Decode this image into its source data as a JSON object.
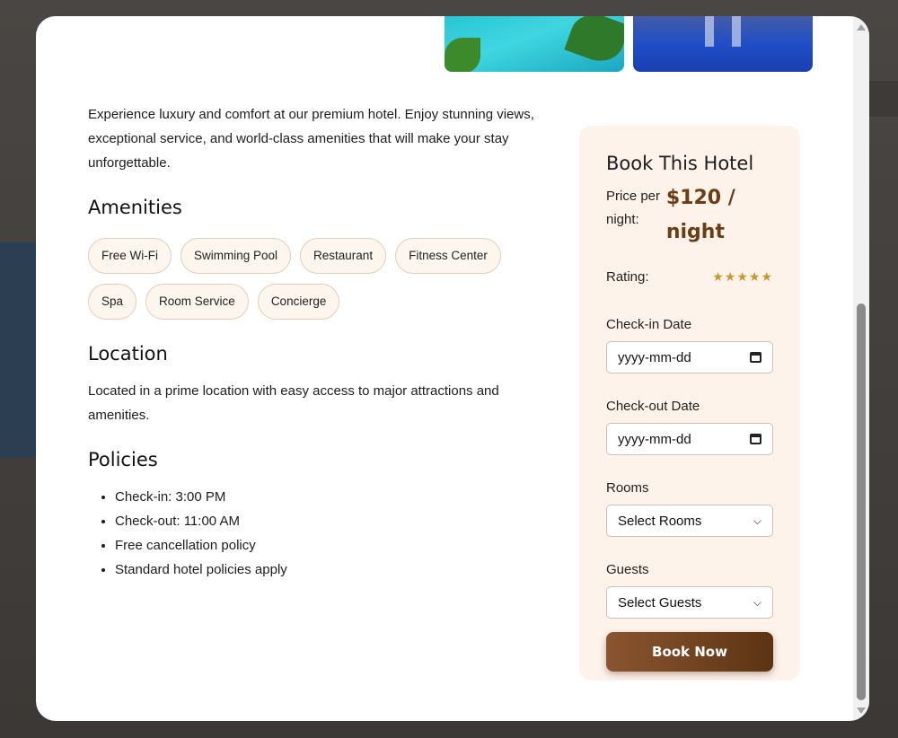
{
  "intro": "Experience luxury and comfort at our premium hotel. Enjoy stunning views, exceptional service, and world-class amenities that will make your stay unforgettable.",
  "amenities": {
    "title": "Amenities",
    "items": [
      "Free Wi-Fi",
      "Swimming Pool",
      "Restaurant",
      "Fitness Center",
      "Spa",
      "Room Service",
      "Concierge"
    ]
  },
  "location": {
    "title": "Location",
    "text": "Located in a prime location with easy access to major attractions and amenities."
  },
  "policies": {
    "title": "Policies",
    "items": [
      "Check-in: 3:00 PM",
      "Check-out: 11:00 AM",
      "Free cancellation policy",
      "Standard hotel policies apply"
    ]
  },
  "booking": {
    "title": "Book This Hotel",
    "price_label": "Price per night:",
    "price_value": "$120 / night",
    "rating_label": "Rating:",
    "rating_stars": "★★★★★",
    "checkin_label": "Check-in Date",
    "checkin_placeholder": "yyyy-mm-dd",
    "checkout_label": "Check-out Date",
    "checkout_placeholder": "yyyy-mm-dd",
    "rooms_label": "Rooms",
    "rooms_value": "Select Rooms",
    "guests_label": "Guests",
    "guests_value": "Select Guests",
    "book_button": "Book Now"
  },
  "colors": {
    "accent": "#6b3d14",
    "chip_bg": "#fdf6ef",
    "panel_bg": "#fdf3eb",
    "star": "#c8962e"
  },
  "icons": [
    "calendar-icon",
    "chevron-down-icon",
    "scroll-up-arrow",
    "scroll-down-arrow"
  ]
}
